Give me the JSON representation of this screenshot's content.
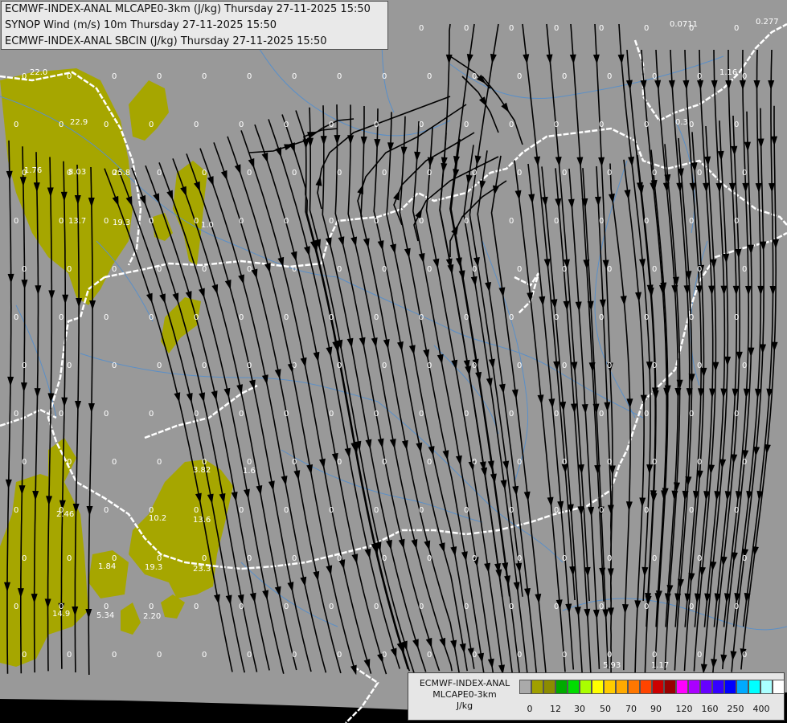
{
  "title_lines": [
    "ECMWF-INDEX-ANAL MLCAPE0-3km (J/kg) Thursday 27-11-2025 15:50",
    "SYNOP Wind (m/s) 10m Thursday 27-11-2025 15:50",
    "ECMWF-INDEX-ANAL SBCIN (J/kg) Thursday 27-11-2025 15:50"
  ],
  "legend": {
    "title_lines": [
      "ECMWF-INDEX-ANAL",
      "MLCAPE0-3km",
      "J/kg"
    ],
    "colors": [
      "#aaaaaa",
      "#a0a000",
      "#8c8c00",
      "#00aa00",
      "#00dd00",
      "#aaff00",
      "#ffff00",
      "#ffcc00",
      "#ffaa00",
      "#ff7700",
      "#ff4400",
      "#cc0000",
      "#990000",
      "#ff00ff",
      "#aa00ff",
      "#6600ff",
      "#3300ff",
      "#0000ff",
      "#00aaff",
      "#00ffff",
      "#aaffff",
      "#ffffff"
    ],
    "ticks": [
      "0",
      "12",
      "30",
      "50",
      "70",
      "90",
      "120",
      "160",
      "250",
      "400"
    ]
  },
  "map_colors": {
    "background": "#999999",
    "cape_fill": "#a6a600",
    "border": "#ffffff",
    "rivers": "#5a8fc8",
    "streamlines": "#000000",
    "labels": "#ffffff"
  },
  "values": {
    "cape": [
      "22.0",
      "22.9",
      "25.8",
      "8.03",
      "1.76",
      "13.7",
      "19.3",
      "2.46",
      "3.82",
      "10.2",
      "13.6",
      "19.3",
      "23.3",
      "1.84",
      "14.9",
      "5.34",
      "2.20",
      "1.6",
      "5.93",
      "1.17",
      "0.0711",
      "0.277",
      "1.16",
      "0.3",
      "1.0"
    ],
    "zero": "0"
  }
}
